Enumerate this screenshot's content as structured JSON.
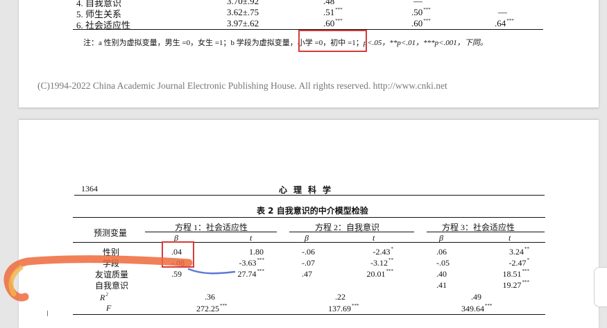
{
  "prev_page": {
    "rows": [
      {
        "label": "4. 自我意识",
        "mean": "3.70±.92",
        "c1": ".48",
        "c1_sig": "***",
        "c2": "—",
        "c2_sig": "",
        "c3": "",
        "c3_sig": ""
      },
      {
        "label": "5. 师生关系",
        "mean": "3.62±.75",
        "c1": ".51",
        "c1_sig": "***",
        "c2": ".50",
        "c2_sig": "***",
        "c3": "—",
        "c3_sig": ""
      },
      {
        "label": "6. 社会适应性",
        "mean": "3.97±.62",
        "c1": ".60",
        "c1_sig": "***",
        "c2": ".60",
        "c2_sig": "***",
        "c3": ".64",
        "c3_sig": "***"
      }
    ],
    "note_pre": "注：a 性别为虚拟变量，男生 =0，女生 =1；b 学段为虚拟变量，",
    "note_boxed": "小学 =0，初中 =1；",
    "note_post": "p<.05，**p<.01，***p<.001，下同。",
    "copyright": "(C)1994-2022 China Academic Journal Electronic Publishing House. All rights reserved.    http://www.cnki.net"
  },
  "page": {
    "number": "1364",
    "journal": "心理科学",
    "table_title": "表 2  自我意识的中介模型检验",
    "predictor_header": "预测变量",
    "equations": [
      "方程 1：社会适应性",
      "方程 2：自我意识",
      "方程 3：社会适应性"
    ],
    "beta": "β",
    "t": "t",
    "rows": [
      {
        "label": "性别",
        "v": [
          ".04",
          "",
          "1.80",
          "",
          "-.06",
          "",
          "-2.43",
          "*",
          ".06",
          "",
          "3.24",
          "**"
        ]
      },
      {
        "label": "学段",
        "v": [
          "-.08",
          "",
          "-3.63",
          "***",
          "-.07",
          "",
          "-3.12",
          "**",
          "-.05",
          "",
          "-2.47",
          "*"
        ]
      },
      {
        "label": "友谊质量",
        "v": [
          ".59",
          "",
          "27.74",
          "***",
          ".47",
          "",
          "20.01",
          "***",
          ".40",
          "",
          "18.51",
          "***"
        ]
      },
      {
        "label": "自我意识",
        "v": [
          "",
          "",
          "",
          "",
          "",
          "",
          "",
          "",
          ".41",
          "",
          "19.27",
          "***"
        ]
      }
    ],
    "r2_label": "R",
    "r2_sup": "2",
    "r2": [
      ".36",
      ".22",
      ".49"
    ],
    "f_label": "F",
    "f": [
      {
        "v": "272.25",
        "sig": "***"
      },
      {
        "v": "137.69",
        "sig": "***"
      },
      {
        "v": "349.64",
        "sig": "***"
      }
    ]
  },
  "annotation_colors": {
    "box": "#d63a3a",
    "stroke_warm": "#ee6a3c",
    "stroke_cool": "#5e78d6"
  }
}
